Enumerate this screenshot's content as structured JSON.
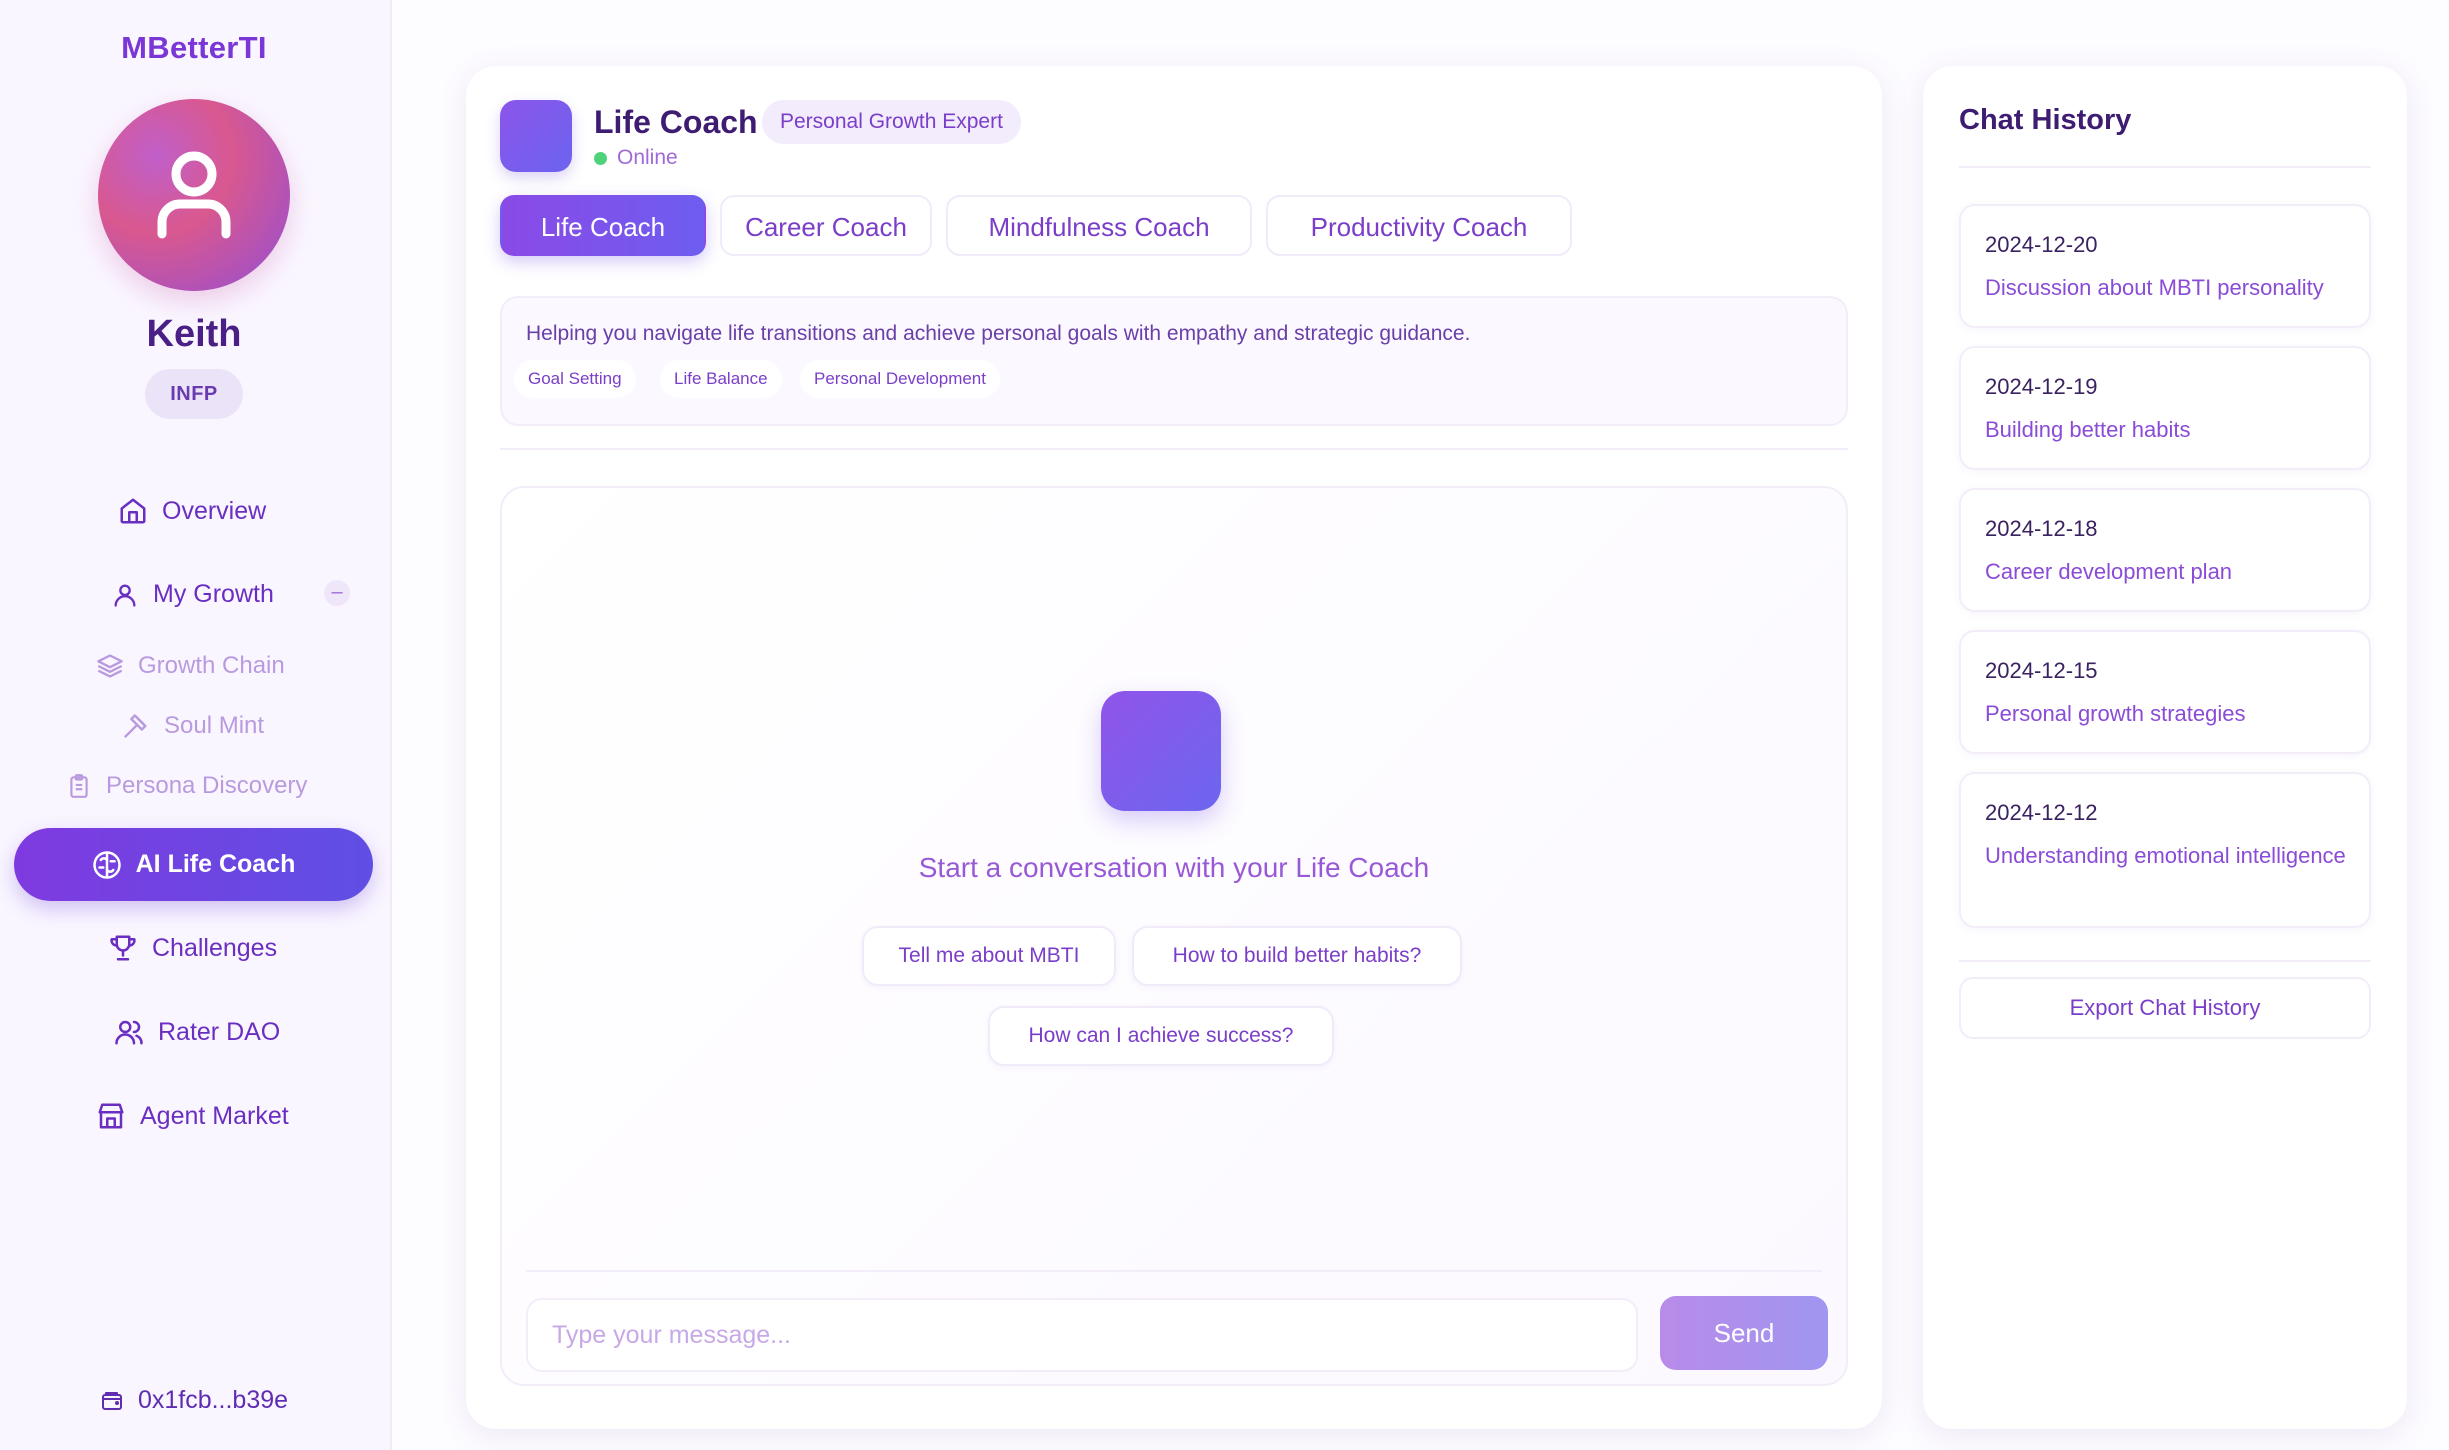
{
  "sidebar": {
    "brand": "MBetterTI",
    "user": {
      "name": "Keith",
      "mbti": "INFP"
    },
    "nav": {
      "overview": "Overview",
      "my_growth": "My Growth",
      "collapse_symbol": "–",
      "growth_chain": "Growth Chain",
      "soul_mint": "Soul Mint",
      "persona_discovery": "Persona Discovery",
      "ai_life_coach": "AI Life Coach",
      "challenges": "Challenges",
      "rater_dao": "Rater DAO",
      "agent_market": "Agent Market"
    },
    "wallet": "0x1fcb...b39e"
  },
  "coach": {
    "title": "Life Coach",
    "tag": "Personal Growth Expert",
    "status": "Online",
    "tabs": [
      {
        "label": "Life Coach",
        "active": true
      },
      {
        "label": "Career Coach",
        "active": false
      },
      {
        "label": "Mindfulness Coach",
        "active": false
      },
      {
        "label": "Productivity Coach",
        "active": false
      }
    ],
    "description": "Helping you navigate life transitions and achieve personal goals with empathy and strategic guidance.",
    "tags": [
      "Goal Setting",
      "Life Balance",
      "Personal Development"
    ]
  },
  "chat": {
    "prompt": "Start a conversation with your Life Coach",
    "suggestions": [
      "Tell me about MBTI",
      "How to build better habits?",
      "How can I achieve success?"
    ],
    "input_placeholder": "Type your message...",
    "input_value": "",
    "send_label": "Send"
  },
  "history": {
    "title": "Chat History",
    "items": [
      {
        "date": "2024-12-20",
        "topic": "Discussion about MBTI personality"
      },
      {
        "date": "2024-12-19",
        "topic": "Building better habits"
      },
      {
        "date": "2024-12-18",
        "topic": "Career development plan"
      },
      {
        "date": "2024-12-15",
        "topic": "Personal growth strategies"
      },
      {
        "date": "2024-12-12",
        "topic": "Understanding emotional intelligence"
      }
    ],
    "export_label": "Export Chat History"
  },
  "colors": {
    "accent": "#7a36d6",
    "accent_gradient_start": "#8a4ae6",
    "accent_gradient_end": "#5f4fe4",
    "online": "#4ed27a",
    "sidebar_bg": "#faf6ff"
  }
}
